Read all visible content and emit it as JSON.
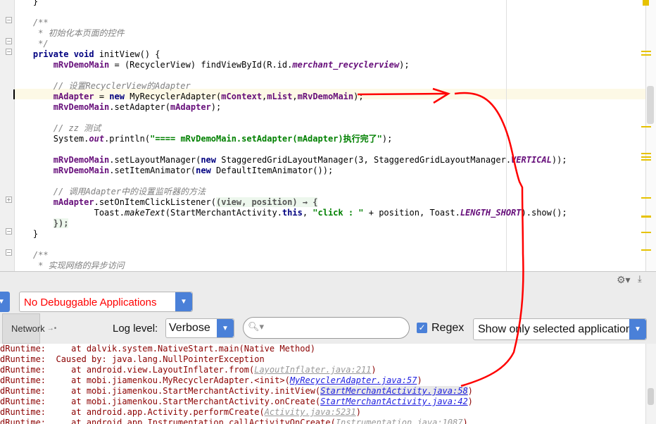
{
  "editor": {
    "code_lines": [
      [
        [
          "    }",
          "pl"
        ]
      ],
      [],
      [
        [
          "    /**",
          "cm"
        ]
      ],
      [
        [
          "     * 初始化本页面的控件",
          "cm"
        ]
      ],
      [
        [
          "     */",
          "cm"
        ]
      ],
      [
        [
          "    ",
          "pl"
        ],
        [
          "private void",
          "kw"
        ],
        [
          " initView() {",
          "pl"
        ]
      ],
      [
        [
          "        ",
          "pl"
        ],
        [
          "mRvDemoMain",
          "fld"
        ],
        [
          " = (RecyclerView) findViewById(R.id.",
          "pl"
        ],
        [
          "merchant_recyclerview",
          "itf"
        ],
        [
          ");",
          "pl"
        ]
      ],
      [],
      [
        [
          "        // 设置RecyclerView的Adapter",
          "cm"
        ]
      ],
      [
        [
          "        ",
          "pl"
        ],
        [
          "mAdapter",
          "fld"
        ],
        [
          " = ",
          "pl"
        ],
        [
          "new",
          "kw"
        ],
        [
          " MyRecyclerAdapter(",
          "pl"
        ],
        [
          "mContext",
          "fld"
        ],
        [
          ",",
          "pl"
        ],
        [
          "mList",
          "fld"
        ],
        [
          ",",
          "pl"
        ],
        [
          "mRvDemoMain",
          "fld"
        ],
        [
          ");",
          "pl"
        ]
      ],
      [
        [
          "        ",
          "pl"
        ],
        [
          "mRvDemoMain",
          "fld"
        ],
        [
          ".setAdapter(",
          "pl"
        ],
        [
          "mAdapter",
          "fld"
        ],
        [
          ");",
          "pl"
        ]
      ],
      [],
      [
        [
          "        // zz 测试",
          "cm"
        ]
      ],
      [
        [
          "        System.",
          "pl"
        ],
        [
          "out",
          "itf"
        ],
        [
          ".println(",
          "pl"
        ],
        [
          "\"==== mRvDemoMain.setAdapter(mAdapter)执行完了\"",
          "str"
        ],
        [
          ");",
          "pl"
        ]
      ],
      [],
      [
        [
          "        ",
          "pl"
        ],
        [
          "mRvDemoMain",
          "fld"
        ],
        [
          ".setLayoutManager(",
          "pl"
        ],
        [
          "new",
          "kw"
        ],
        [
          " StaggeredGridLayoutManager(3, StaggeredGridLayoutManager.",
          "pl"
        ],
        [
          "VERTICAL",
          "itf"
        ],
        [
          "));",
          "pl"
        ]
      ],
      [
        [
          "        ",
          "pl"
        ],
        [
          "mRvDemoMain",
          "fld"
        ],
        [
          ".setItemAnimator(",
          "pl"
        ],
        [
          "new",
          "kw"
        ],
        [
          " DefaultItemAnimator());",
          "pl"
        ]
      ],
      [],
      [
        [
          "        // 调用Adapter中的设置监听器的方法",
          "cm"
        ]
      ],
      [
        [
          "        ",
          "pl"
        ],
        [
          "mAdapter",
          "fld"
        ],
        [
          ".setOnItemClickListener(",
          "pl"
        ],
        [
          "(view, position) → {",
          "lam"
        ]
      ],
      [
        [
          "                Toast.",
          "pl"
        ],
        [
          "makeText",
          "it"
        ],
        [
          "(StartMerchantActivity.",
          "pl"
        ],
        [
          "this",
          "kw"
        ],
        [
          ", ",
          "pl"
        ],
        [
          "\"click : \"",
          "str"
        ],
        [
          " + position, Toast.",
          "pl"
        ],
        [
          "LENGTH_SHORT",
          "itf"
        ],
        [
          ").show();",
          "pl"
        ]
      ],
      [
        [
          "        ",
          "pl"
        ],
        [
          "});",
          "lam"
        ]
      ],
      [
        [
          "    }",
          "pl"
        ]
      ],
      [],
      [
        [
          "    /**",
          "cm"
        ]
      ],
      [
        [
          "     * 实现网络的异步访问",
          "cm"
        ]
      ],
      [
        [
          "     */",
          "cm"
        ]
      ]
    ]
  },
  "panel": {
    "settings_icon": "gear-icon",
    "hide_icon": "pin-down-icon"
  },
  "device_row": {
    "app_select_value": "No Debuggable Applications",
    "app_select_color": "#ff0000"
  },
  "logcat_toolbar": {
    "tab_label": "Network",
    "log_level_label": "Log level:",
    "log_level_value": "Verbose",
    "search_placeholder": "",
    "regex_label": "Regex",
    "regex_checked": true,
    "filter_value": "Show only selected application"
  },
  "log": {
    "lines": [
      [
        [
          "dRuntime:     at dalvik.system.NativeStart.main(Native Method)",
          "pl"
        ]
      ],
      [
        [
          "dRuntime:  Caused by: java.lang.NullPointerException",
          "pl"
        ]
      ],
      [
        [
          "dRuntime:     at android.view.LayoutInflater.from(",
          "pl"
        ],
        [
          "LayoutInflater.java:211",
          "lnkg"
        ],
        [
          ")",
          "pl"
        ]
      ],
      [
        [
          "dRuntime:     at mobi.jiamenkou.MyRecyclerAdapter.<init>(",
          "pl"
        ],
        [
          "MyRecyclerAdapter.java:57",
          "lnk"
        ],
        [
          ")",
          "pl"
        ]
      ],
      [
        [
          "dRuntime:     at mobi.jiamenkou.StartMerchantActivity.initView(",
          "pl"
        ],
        [
          "StartMerchantActivity.java:58",
          "lnk lnkh"
        ],
        [
          ")",
          "pl"
        ]
      ],
      [
        [
          "dRuntime:     at mobi.jiamenkou.StartMerchantActivity.onCreate(",
          "pl"
        ],
        [
          "StartMerchantActivity.java:42",
          "lnk"
        ],
        [
          ")",
          "pl"
        ]
      ],
      [
        [
          "dRuntime:     at android.app.Activity.performCreate(",
          "pl"
        ],
        [
          "Activity.java:5231",
          "lnkg"
        ],
        [
          ")",
          "pl"
        ]
      ],
      [
        [
          "dRuntime:     at android.app.Instrumentation.callActivityOnCreate(",
          "pl"
        ],
        [
          "Instrumentation.java:1087",
          "lnkg"
        ],
        [
          ")",
          "pl"
        ]
      ]
    ]
  },
  "colors": {
    "annotation": "#ff0000",
    "accent": "#4a80d8",
    "error_text": "#8b0000",
    "link": "#2020e0"
  }
}
